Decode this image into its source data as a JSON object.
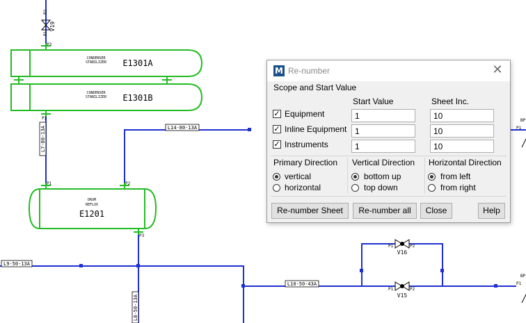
{
  "drawing": {
    "vessels": [
      {
        "tag": "E1301A",
        "service": [
          "CONDENSER",
          "STABILIZER"
        ]
      },
      {
        "tag": "E1301B",
        "service": [
          "CONDENSER",
          "STABILIZER"
        ]
      },
      {
        "tag": "E1201",
        "service": [
          "DRUM",
          "REFLUX"
        ]
      }
    ],
    "valves": [
      "V19",
      "V16",
      "V15"
    ],
    "lines": [
      "L14-80-13A",
      "L7-80-13A",
      "L9-50-13A",
      "L10-50-43A",
      "L8-50-13A"
    ],
    "ports": {
      "p1": "P1",
      "p2": "P2",
      "p3": "P3",
      "bp": "BP"
    }
  },
  "dialog": {
    "title": "Re-number",
    "section_scope": "Scope and Start Value",
    "col_start": "Start Value",
    "col_sheet": "Sheet Inc.",
    "rows": [
      {
        "label": "Equipment",
        "checked": true,
        "start": "1",
        "sheet": "10"
      },
      {
        "label": "Inline Equipment",
        "checked": true,
        "start": "1",
        "sheet": "10"
      },
      {
        "label": "Instruments",
        "checked": true,
        "start": "1",
        "sheet": "10"
      }
    ],
    "primary": {
      "title": "Primary Direction",
      "opt1": "vertical",
      "opt2": "horizontal"
    },
    "vertical": {
      "title": "Vertical Direction",
      "opt1": "bottom up",
      "opt2": "top down"
    },
    "horizontal": {
      "title": "Horizontal Direction",
      "opt1": "from left",
      "opt2": "from right"
    },
    "buttons": {
      "sheet": "Re-number Sheet",
      "all": "Re-number all",
      "close": "Close",
      "help": "Help"
    },
    "check_glyph": "✓",
    "close_glyph": "✕",
    "icon_letter": "M"
  },
  "colors": {
    "pipe": "#1f2fd0",
    "equipment": "#22bb22",
    "dialog_bg": "#f0f0f0"
  }
}
